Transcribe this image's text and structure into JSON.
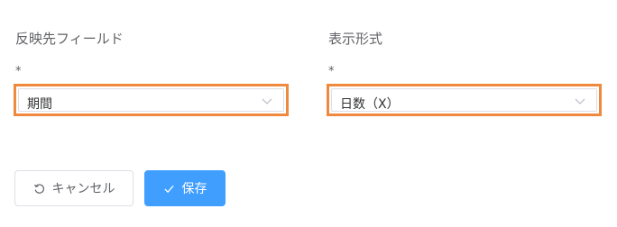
{
  "fields": [
    {
      "label": "反映先フィールド",
      "required_mark": "*",
      "value": "期間",
      "dropdown_icon": "chevron-down-icon"
    },
    {
      "label": "表示形式",
      "required_mark": "*",
      "value": "日数（X）",
      "dropdown_icon": "chevron-down-icon"
    }
  ],
  "actions": {
    "cancel_label": "キャンセル",
    "cancel_icon": "undo-icon",
    "save_label": "保存",
    "save_icon": "check-icon"
  },
  "colors": {
    "highlight_border": "#f0883e",
    "primary": "#409eff",
    "label_text": "#606266",
    "input_border": "#dcdfe6"
  }
}
